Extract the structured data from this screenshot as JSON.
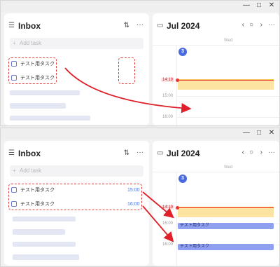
{
  "window": {
    "minimize": "—",
    "maximize": "□",
    "close": "✕"
  },
  "inbox": {
    "title": "Inbox",
    "add_placeholder": "Add task",
    "sort_icon": "⇅",
    "more_icon": "···"
  },
  "calendar": {
    "title": "Jul 2024",
    "weekday": "Wed",
    "day": "3",
    "now": "14:19",
    "prev_icon": "‹",
    "next_icon": "›",
    "today_icon": "○",
    "more_icon": "···"
  },
  "top_shot": {
    "tasks": [
      "テスト用タスク",
      "テスト用タスク"
    ],
    "hours": [
      "15:00",
      "16:00"
    ]
  },
  "bottom_shot": {
    "tasks": [
      {
        "label": "テスト用タスク",
        "time": "15:00"
      },
      {
        "label": "テスト用タスク",
        "time": "16:00"
      }
    ],
    "hours": [
      "15:00",
      "16:00"
    ],
    "scheduled": [
      "テスト用タスク",
      "テスト用タスク"
    ]
  },
  "colors": {
    "accent": "#4a6be0",
    "annotation": "#e0403e",
    "event": "#fde3a1",
    "scheduled": "#8fa0f0"
  }
}
